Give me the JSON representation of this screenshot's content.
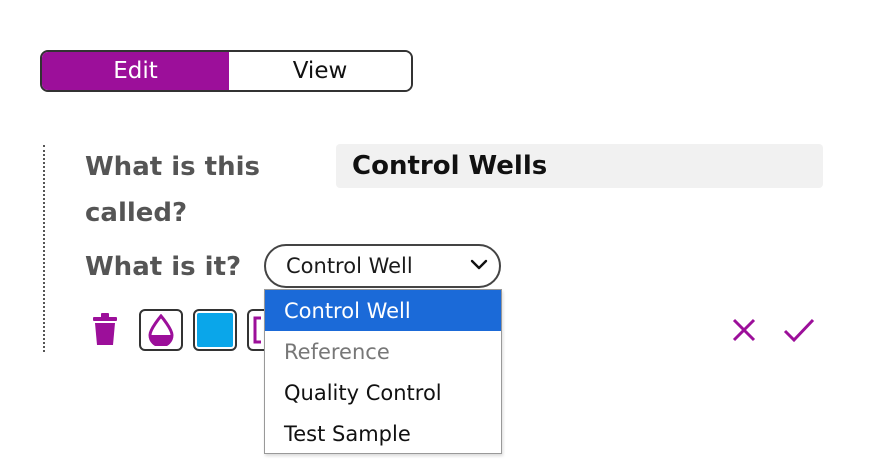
{
  "mode": {
    "edit_label": "Edit",
    "view_label": "View",
    "active": "Edit"
  },
  "form": {
    "name_label": "What is this called?",
    "name_value": "Control Wells",
    "type_label": "What is it?",
    "type_value": "Control Well"
  },
  "dropdown": {
    "options": [
      {
        "label": "Control Well",
        "state": "selected"
      },
      {
        "label": "Reference",
        "state": "disabled"
      },
      {
        "label": "Quality Control",
        "state": "enabled"
      },
      {
        "label": "Test Sample",
        "state": "enabled"
      }
    ]
  },
  "icons": {
    "delete": "trash-icon",
    "well_style": "droplet-icon",
    "color": "color-swatch-icon",
    "size": "resize-icon",
    "cancel": "close-icon",
    "confirm": "checkmark-icon"
  },
  "colors": {
    "accent": "#9c0f9a",
    "swatch": "#0aa6ea",
    "selected_option": "#1b6ad8"
  }
}
